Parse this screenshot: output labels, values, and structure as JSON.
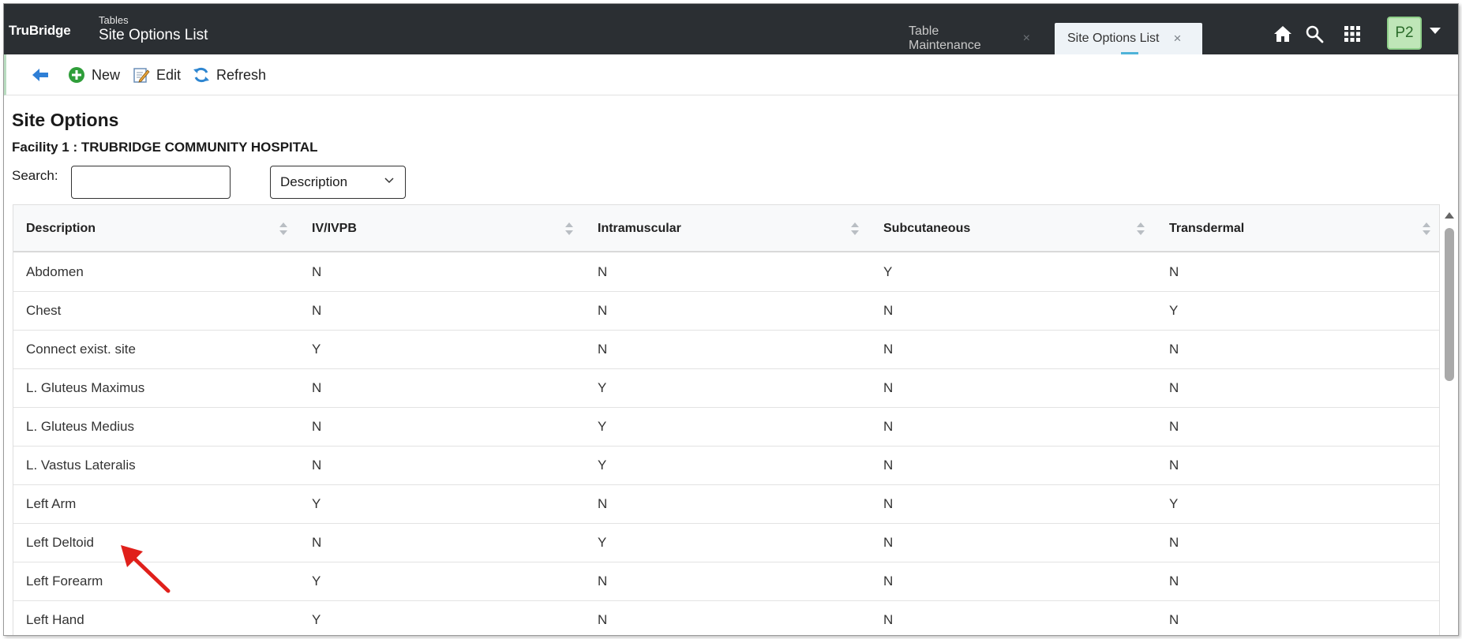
{
  "header": {
    "brand": "TruBridge",
    "subtitle": "Tables",
    "title": "Site Options List",
    "tabs": [
      {
        "label": "Table Maintenance",
        "close": "×",
        "active": false
      },
      {
        "label": "Site Options List",
        "close": "×",
        "active": true
      }
    ],
    "icons": [
      "home-icon",
      "search-icon",
      "apps-grid-icon"
    ],
    "avatar": "P2"
  },
  "toolbar": {
    "back_icon": "back-arrow-icon",
    "new_label": "New",
    "edit_label": "Edit",
    "refresh_label": "Refresh"
  },
  "page": {
    "section_title": "Site Options",
    "facility": "Facility 1 : TRUBRIDGE COMMUNITY HOSPITAL",
    "search_label": "Search:",
    "search_value": "",
    "search_field_selected": "Description"
  },
  "table": {
    "columns": [
      "Description",
      "IV/IVPB",
      "Intramuscular",
      "Subcutaneous",
      "Transdermal"
    ],
    "rows": [
      [
        "Abdomen",
        "N",
        "N",
        "Y",
        "N"
      ],
      [
        "Chest",
        "N",
        "N",
        "N",
        "Y"
      ],
      [
        "Connect exist. site",
        "Y",
        "N",
        "N",
        "N"
      ],
      [
        "L. Gluteus Maximus",
        "N",
        "Y",
        "N",
        "N"
      ],
      [
        "L. Gluteus Medius",
        "N",
        "Y",
        "N",
        "N"
      ],
      [
        "L. Vastus Lateralis",
        "N",
        "Y",
        "N",
        "N"
      ],
      [
        "Left Arm",
        "Y",
        "N",
        "N",
        "Y"
      ],
      [
        "Left Deltoid",
        "N",
        "Y",
        "N",
        "N"
      ],
      [
        "Left Forearm",
        "Y",
        "N",
        "N",
        "N"
      ],
      [
        "Left Hand",
        "Y",
        "N",
        "N",
        "N"
      ]
    ]
  },
  "colors": {
    "header_bg": "#2b2f33",
    "avatar_bg": "#bfe6b8",
    "annotation_arrow": "#e0201b",
    "tab_indicator": "#4fb3d9"
  }
}
